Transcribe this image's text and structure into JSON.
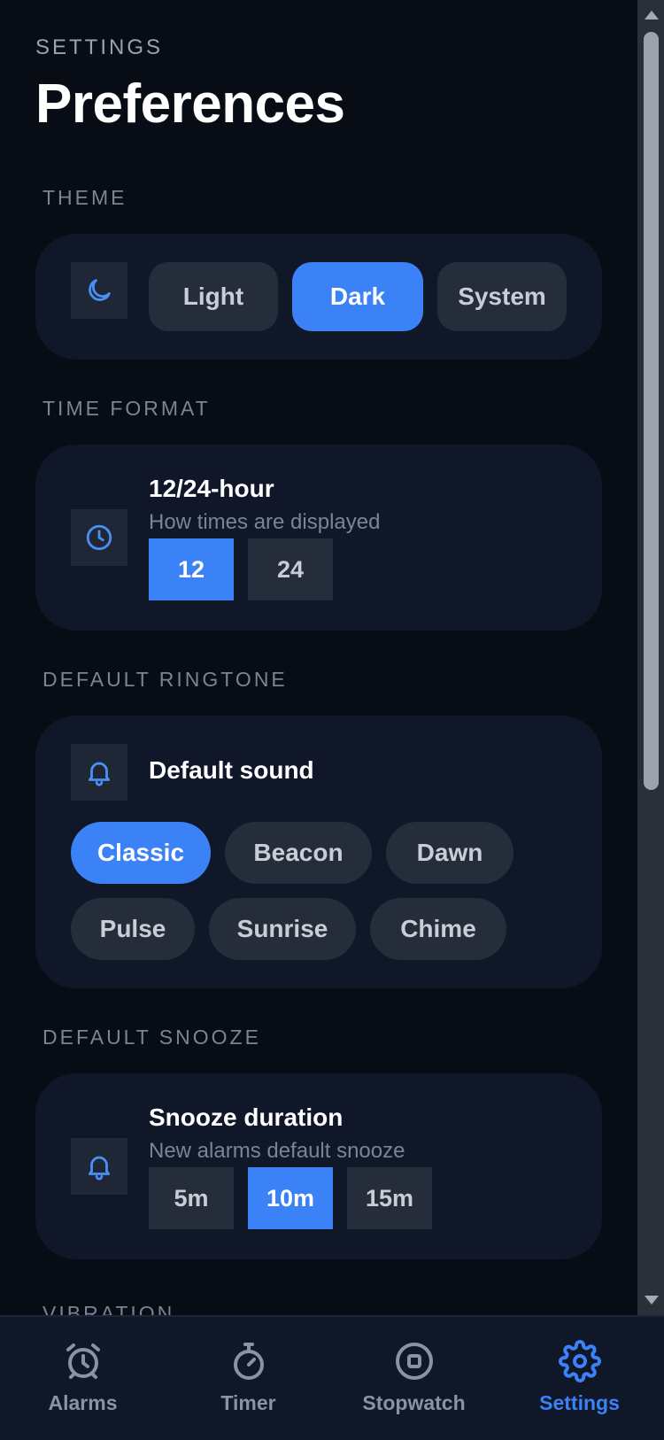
{
  "header": {
    "eyebrow": "SETTINGS",
    "title": "Preferences"
  },
  "sections": {
    "theme": {
      "label": "THEME",
      "icon": "moon-icon",
      "options": [
        "Light",
        "Dark",
        "System"
      ],
      "selected": "Dark"
    },
    "time_format": {
      "label": "TIME FORMAT",
      "icon": "clock-icon",
      "title": "12/24-hour",
      "subtitle": "How times are displayed",
      "options": [
        "12",
        "24"
      ],
      "selected": "12"
    },
    "ringtone": {
      "label": "DEFAULT RINGTONE",
      "icon": "bell-icon",
      "title": "Default sound",
      "options": [
        "Classic",
        "Beacon",
        "Dawn",
        "Pulse",
        "Sunrise",
        "Chime"
      ],
      "selected": "Classic"
    },
    "snooze": {
      "label": "DEFAULT SNOOZE",
      "icon": "bell-icon",
      "title": "Snooze duration",
      "subtitle": "New alarms default snooze",
      "options": [
        "5m",
        "10m",
        "15m"
      ],
      "selected": "10m"
    },
    "vibration": {
      "label": "VIBRATION"
    }
  },
  "tabs": [
    {
      "label": "Alarms",
      "icon": "alarm-clock-icon"
    },
    {
      "label": "Timer",
      "icon": "stopwatch-icon"
    },
    {
      "label": "Stopwatch",
      "icon": "stop-circle-icon"
    },
    {
      "label": "Settings",
      "icon": "gear-icon",
      "active": true
    }
  ],
  "colors": {
    "accent": "#3b82f6",
    "background": "#080c14",
    "card": "#0f1728",
    "chip": "#252d3b"
  }
}
